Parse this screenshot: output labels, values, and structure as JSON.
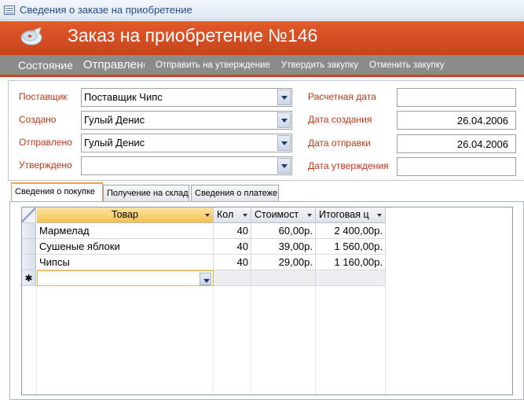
{
  "window": {
    "title": "Сведения о заказе на приобретение",
    "icon": "form-icon"
  },
  "header": {
    "title": "Заказ на приобретение №146",
    "logo": "cd-logo-icon"
  },
  "toolbar": {
    "status_label": "Состояние",
    "status_value": "Отправлено",
    "actions": [
      "Отправить на утверждение",
      "Утвердить закупку",
      "Отменить закупку"
    ]
  },
  "form": {
    "supplier": {
      "label": "Поставщик",
      "value": "Поставщик Чипс"
    },
    "created": {
      "label": "Создано",
      "value": "Гулый Денис"
    },
    "sent": {
      "label": "Отправлено",
      "value": "Гулый Денис"
    },
    "approved": {
      "label": "Утверждено",
      "value": ""
    },
    "expected_date": {
      "label": "Расчетная дата",
      "value": ""
    },
    "creation_date": {
      "label": "Дата создания",
      "value": "26.04.2006"
    },
    "sent_date": {
      "label": "Дата отправки",
      "value": "26.04.2006"
    },
    "approval_date": {
      "label": "Дата утверждения",
      "value": ""
    }
  },
  "tabs": [
    "Сведения о покупке",
    "Получение на склад",
    "Сведения о платеже"
  ],
  "grid": {
    "columns": [
      "Товар",
      "Кол",
      "Стоимост",
      "Итоговая ц"
    ],
    "rows": [
      {
        "product": "Мармелад",
        "qty": "40",
        "cost": "60,00р.",
        "total": "2 400,00р."
      },
      {
        "product": "Сушеные яблоки",
        "qty": "40",
        "cost": "39,00р.",
        "total": "1 560,00р."
      },
      {
        "product": "Чипсы",
        "qty": "40",
        "cost": "29,00р.",
        "total": "1 160,00р."
      }
    ],
    "new_row_marker": "✱"
  }
}
